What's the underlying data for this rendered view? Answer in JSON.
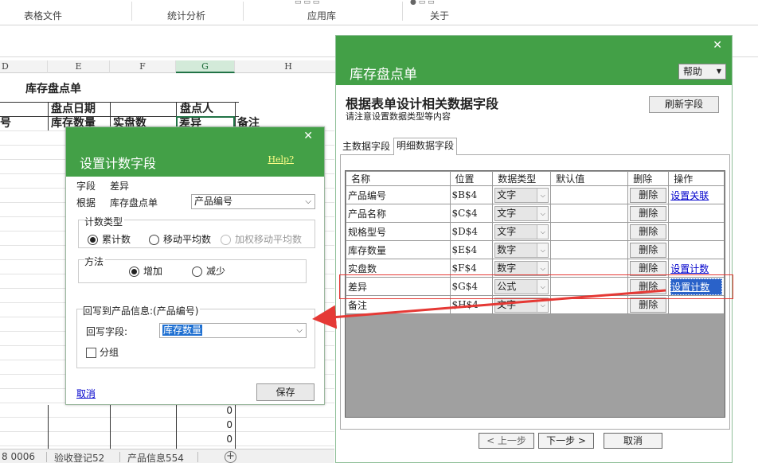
{
  "ribbon": {
    "groups": [
      "表格文件",
      "统计分析",
      "应用库",
      "关于"
    ]
  },
  "sheet": {
    "columns": [
      "D",
      "E",
      "F",
      "G",
      "H"
    ],
    "title": "库存盘点单",
    "row1": {
      "date_label": "盘点日期",
      "person_label": "盘点人"
    },
    "row2": {
      "c0": "号",
      "qty": "库存数量",
      "actual": "实盘数",
      "diff": "差异",
      "note": "备注"
    },
    "zeros": [
      "0",
      "0",
      "0"
    ]
  },
  "sheet_tabs": [
    "8 0006",
    "验收登记52",
    "产品信息554"
  ],
  "main_dialog": {
    "close": "✕",
    "title": "库存盘点单",
    "help": "帮助",
    "heading": "根据表单设计相关数据字段",
    "subheading": "请注意设置数据类型等内容",
    "refresh": "刷新字段",
    "tabs": [
      "主数据字段",
      "明细数据字段"
    ],
    "grid_headers": [
      "名称",
      "位置",
      "数据类型",
      "默认值",
      "删除",
      "操作"
    ],
    "rows": [
      {
        "name": "产品编号",
        "pos": "$B$4",
        "type": "文字",
        "del": "删除",
        "action": "设置关联"
      },
      {
        "name": "产品名称",
        "pos": "$C$4",
        "type": "文字",
        "del": "删除",
        "action": ""
      },
      {
        "name": "规格型号",
        "pos": "$D$4",
        "type": "文字",
        "del": "删除",
        "action": ""
      },
      {
        "name": "库存数量",
        "pos": "$E$4",
        "type": "数字",
        "del": "删除",
        "action": ""
      },
      {
        "name": "实盘数",
        "pos": "$F$4",
        "type": "数字",
        "del": "删除",
        "action": "设置计数"
      },
      {
        "name": "差异",
        "pos": "$G$4",
        "type": "公式",
        "del": "删除",
        "action": "设置计数"
      },
      {
        "name": "备注",
        "pos": "$H$4",
        "type": "文字",
        "del": "删除",
        "action": ""
      }
    ],
    "prev": "< 上一步",
    "next": "下一步 >",
    "cancel": "取消"
  },
  "count_dialog": {
    "close": "✕",
    "title": "设置计数字段",
    "help": "Help?",
    "field_label": "字段",
    "field_value": "差异",
    "basis_label": "根据",
    "basis_value": "库存盘点单",
    "basis_select": "产品编号",
    "count_type_label": "计数类型",
    "count_types": [
      "累计数",
      "移动平均数",
      "加权移动平均数"
    ],
    "method_label": "方法",
    "methods": [
      "增加",
      "减少"
    ],
    "writeback_group": "回写到产品信息:(产品编号)",
    "writeback_label": "回写字段:",
    "writeback_value": "库存数量",
    "group_check": "分组",
    "cancel": "取消",
    "save": "保存"
  },
  "colors": {
    "dialog_green": "#43a047",
    "highlight_red": "#e53935",
    "link_blue": "#0000cc",
    "select_blue": "#2a62c9"
  }
}
